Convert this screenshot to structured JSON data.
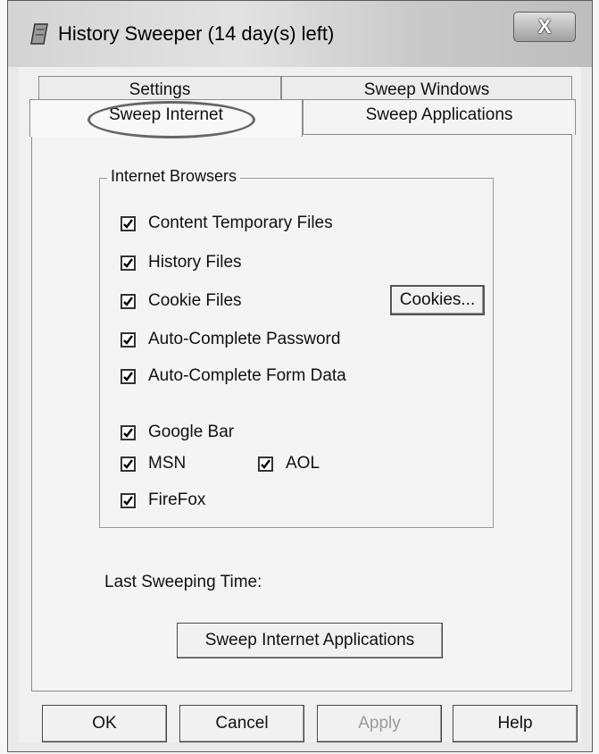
{
  "window": {
    "title": "History Sweeper (14 day(s) left)",
    "close_label": "X"
  },
  "tabs": {
    "back_row": [
      {
        "label": "Settings"
      },
      {
        "label": "Sweep Windows"
      }
    ],
    "front_row": [
      {
        "label": "Sweep Internet",
        "active": true
      },
      {
        "label": "Sweep Applications"
      }
    ]
  },
  "browsers_group": {
    "title": "Internet Browsers",
    "items": [
      {
        "label": "Content Temporary Files",
        "checked": true
      },
      {
        "label": "History Files",
        "checked": true
      },
      {
        "label": "Cookie Files",
        "checked": true
      },
      {
        "label": "Auto-Complete Password",
        "checked": true
      },
      {
        "label": "Auto-Complete Form Data",
        "checked": true
      },
      {
        "label": "Google Bar",
        "checked": true
      },
      {
        "label": "MSN",
        "checked": true
      },
      {
        "label": "AOL",
        "checked": true
      },
      {
        "label": "FireFox",
        "checked": true
      }
    ],
    "cookies_button": "Cookies..."
  },
  "last_sweeping_label": "Last Sweeping Time:",
  "sweep_button": "Sweep Internet Applications",
  "footer": {
    "ok": "OK",
    "cancel": "Cancel",
    "apply": "Apply",
    "help": "Help"
  }
}
